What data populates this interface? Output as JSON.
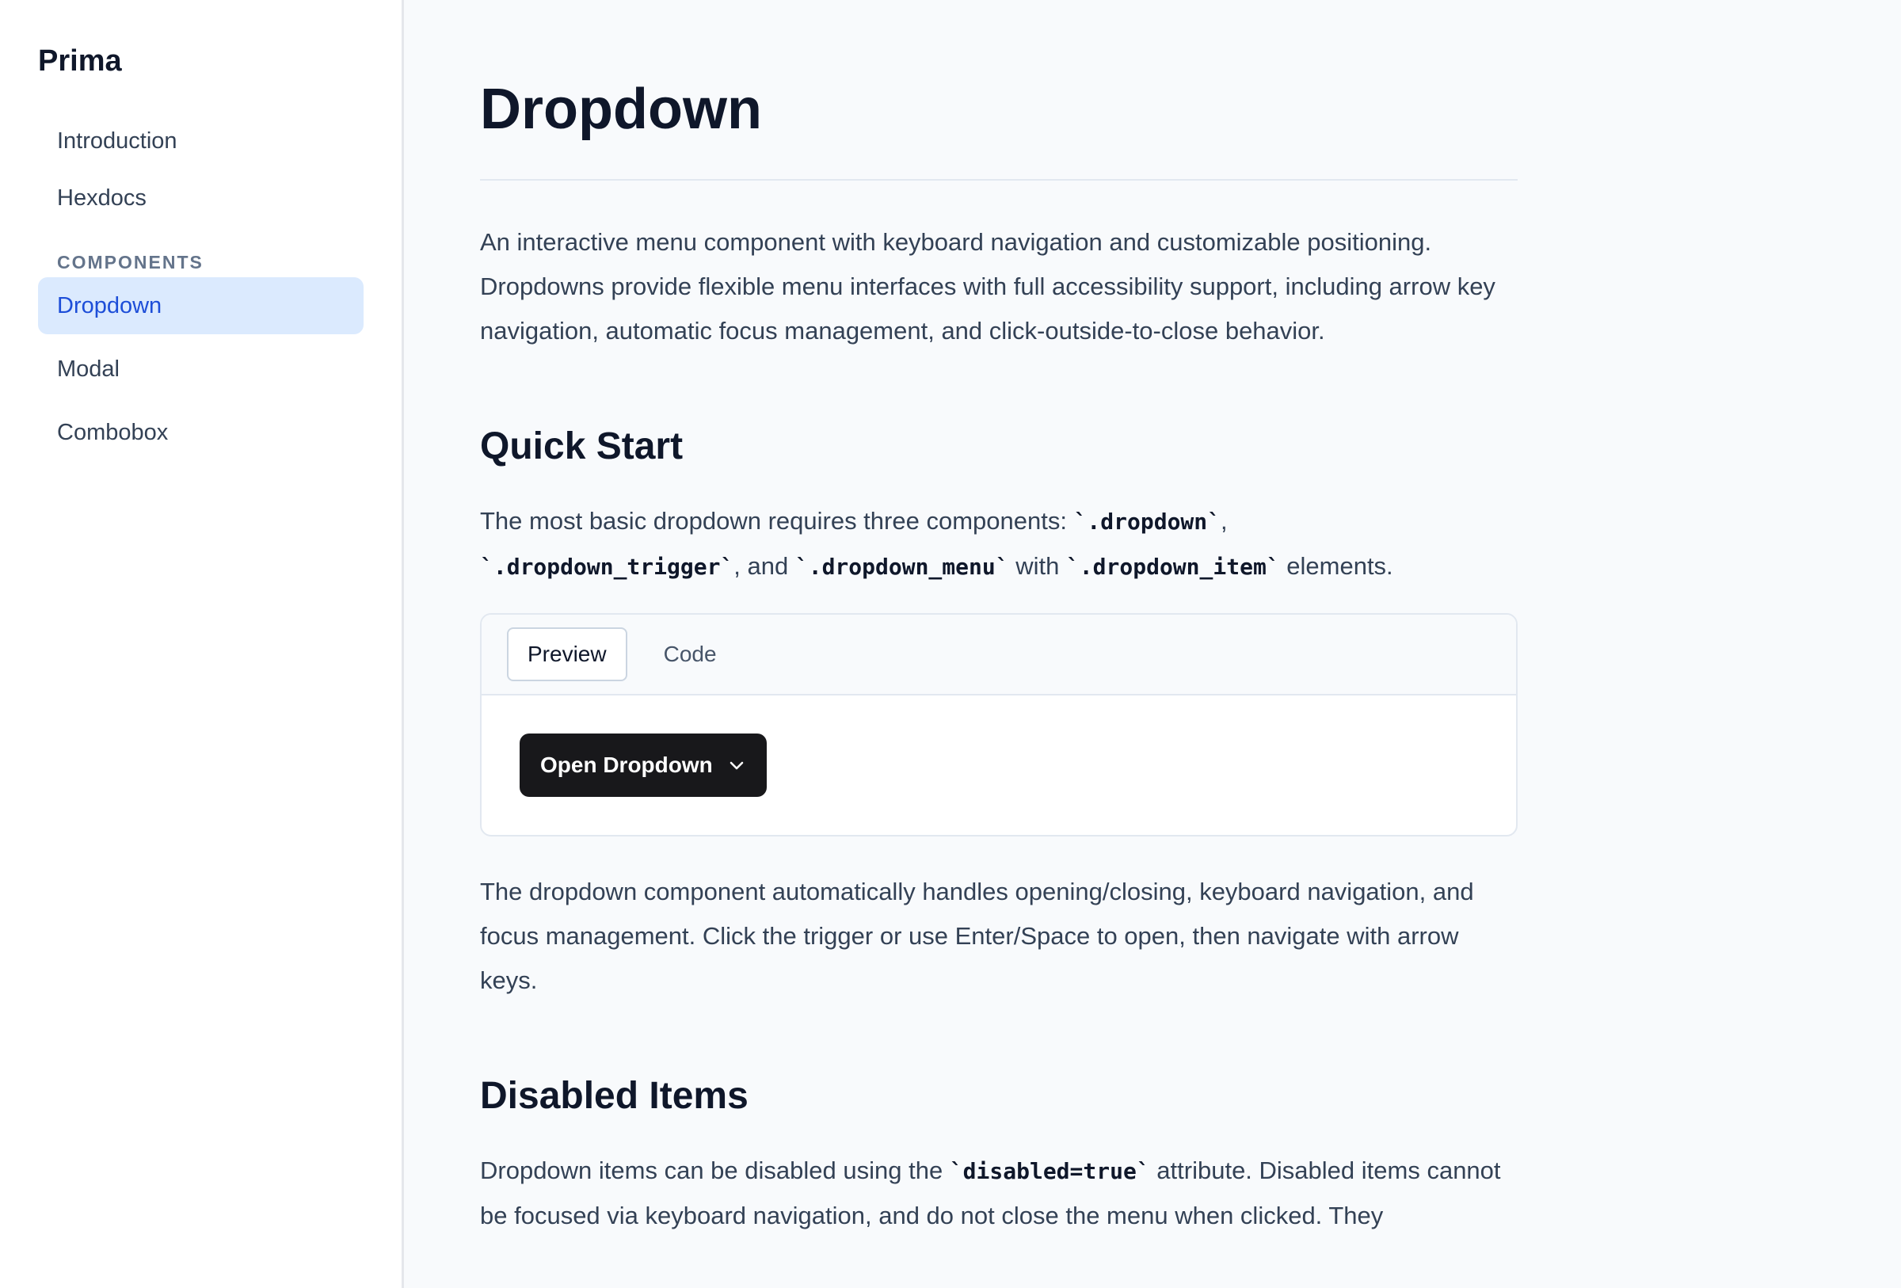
{
  "sidebar": {
    "brand": "Prima",
    "items": [
      {
        "label": "Introduction"
      },
      {
        "label": "Hexdocs"
      }
    ],
    "section_label": "COMPONENTS",
    "components": [
      {
        "label": "Dropdown",
        "active": true
      },
      {
        "label": "Modal"
      },
      {
        "label": "Combobox"
      }
    ]
  },
  "main": {
    "title": "Dropdown",
    "intro": "An interactive menu component with keyboard navigation and customizable positioning. Dropdowns provide flexible menu interfaces with full accessibility support, including arrow key navigation, automatic focus management, and click-outside-to-close behavior.",
    "quick_start": {
      "heading": "Quick Start",
      "p1_a": "The most basic dropdown requires three components: ",
      "code1": "`.dropdown`",
      "p1_b": ", ",
      "code2": "`.dropdown_trigger`",
      "p1_c": ", and ",
      "code3": "`.dropdown_menu`",
      "p1_d": " with ",
      "code4": "`.dropdown_item`",
      "p1_e": " elements.",
      "tabs": [
        {
          "label": "Preview",
          "active": true
        },
        {
          "label": "Code"
        }
      ],
      "button_label": "Open Dropdown",
      "p2": "The dropdown component automatically handles opening/closing, keyboard navigation, and focus management. Click the trigger or use Enter/Space to open, then navigate with arrow keys."
    },
    "disabled_items": {
      "heading": "Disabled Items",
      "p_a": "Dropdown items can be disabled using the ",
      "code": "`disabled=true`",
      "p_b": " attribute. Disabled items cannot be focused via keyboard navigation, and do not close the menu when clicked. They"
    }
  },
  "colors": {
    "accent": "#1d4ed8",
    "active_bg": "#dbeafe",
    "button_bg": "#18181b"
  },
  "icons": {
    "trigger_icon": "chevron-down-icon"
  }
}
